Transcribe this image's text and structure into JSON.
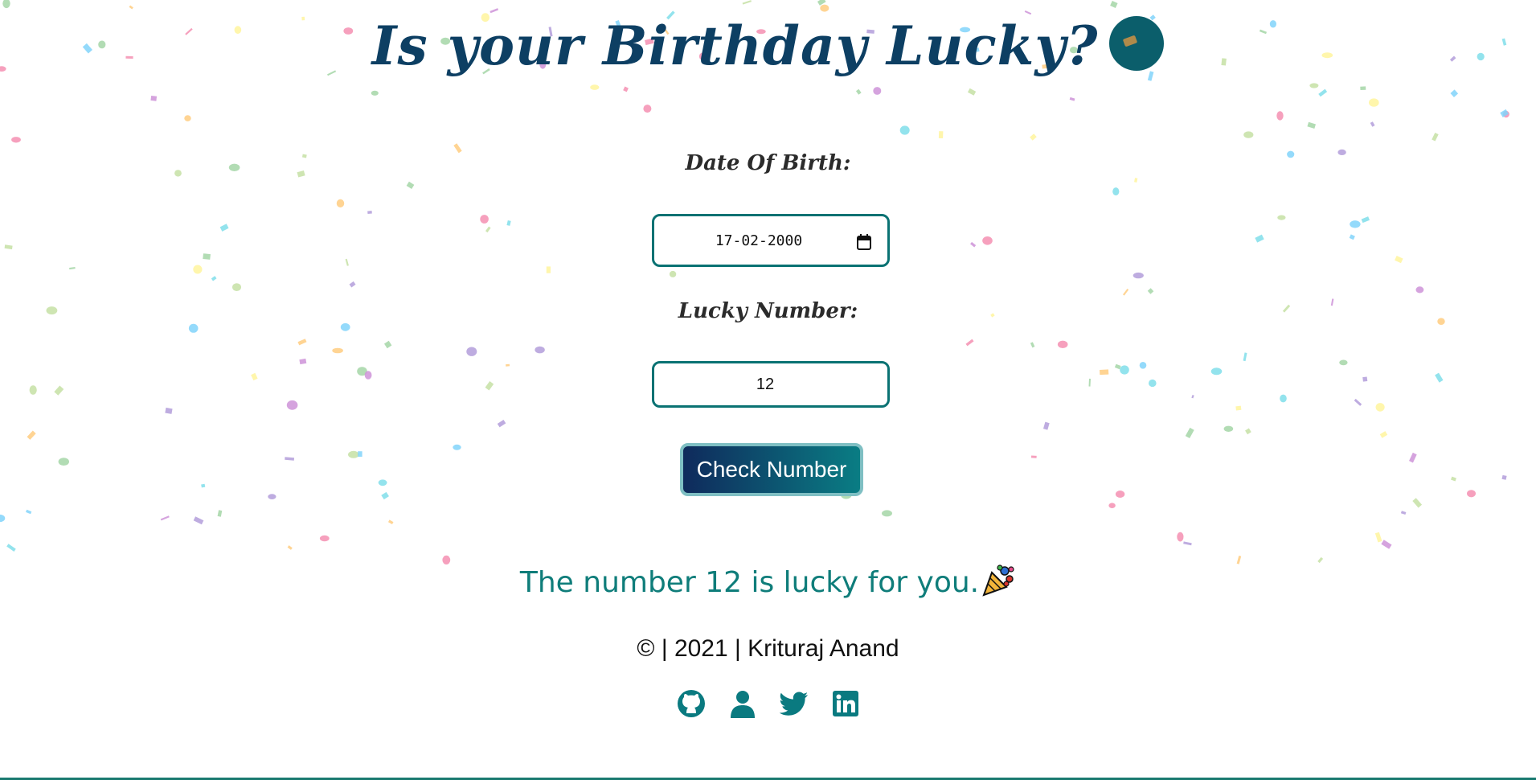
{
  "colors": {
    "title": "#0d3f63",
    "teal": "#0a7a80",
    "field_border": "#0a7273",
    "button_gradient_start": "#0f2a5c",
    "button_gradient_end": "#0a7d84",
    "button_outline": "#7fbfc3",
    "result_text": "#0f7d7a",
    "bottom_line": "#1a7a70",
    "emoji_ball": "#0b5e6b"
  },
  "header": {
    "title": "Is your Birthday Lucky?",
    "emoji_icon": "balloon-emoji-icon"
  },
  "form": {
    "dob_label": "Date Of Birth:",
    "dob_value": "17-02-2000",
    "calendar_icon": "calendar-icon",
    "lucky_label": "Lucky Number:",
    "lucky_value": "12",
    "check_button_label": "Check Number"
  },
  "result": {
    "message": "The number 12 is lucky for you.",
    "icon": "party-popper-icon"
  },
  "footer": {
    "copyright": "© | 2021 | Krituraj Anand",
    "links": [
      {
        "icon": "github-icon"
      },
      {
        "icon": "user-icon"
      },
      {
        "icon": "twitter-icon"
      },
      {
        "icon": "linkedin-icon"
      }
    ]
  }
}
